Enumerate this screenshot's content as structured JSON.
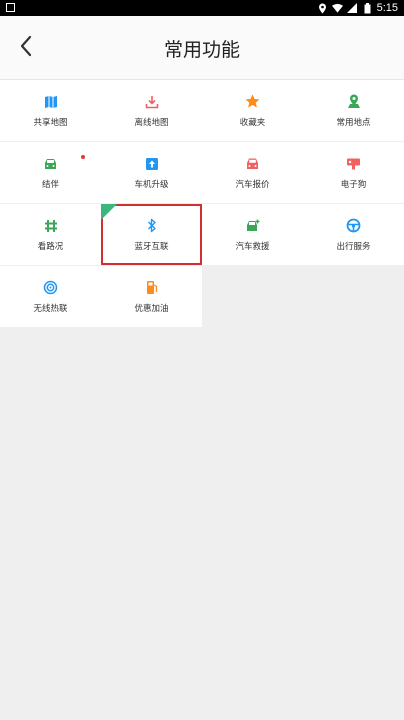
{
  "status_bar": {
    "time": "5:15",
    "icons": [
      "location-icon",
      "wifi-icon",
      "signal-icon",
      "battery-icon"
    ]
  },
  "header": {
    "title": "常用功能",
    "back_icon": "chevron-left-icon"
  },
  "items": [
    {
      "label": "共享地图",
      "icon": "map-icon",
      "color": "#2196f3"
    },
    {
      "label": "离线地图",
      "icon": "download-icon",
      "color": "#f06262"
    },
    {
      "label": "收藏夹",
      "icon": "star-icon",
      "color": "#ff8c1a"
    },
    {
      "label": "常用地点",
      "icon": "location-pin-icon",
      "color": "#3aa757"
    },
    {
      "label": "结伴",
      "icon": "car-group-icon",
      "color": "#3aa757"
    },
    {
      "label": "车机升级",
      "icon": "upgrade-icon",
      "color": "#2196f3"
    },
    {
      "label": "汽车报价",
      "icon": "car-icon",
      "color": "#f06262"
    },
    {
      "label": "电子狗",
      "icon": "camera-icon",
      "color": "#f06262"
    },
    {
      "label": "看路况",
      "icon": "traffic-icon",
      "color": "#3aa757"
    },
    {
      "label": "蓝牙互联",
      "icon": "bluetooth-icon",
      "color": "#2196f3"
    },
    {
      "label": "汽车救援",
      "icon": "car-rescue-icon",
      "color": "#3aa757"
    },
    {
      "label": "出行服务",
      "icon": "steering-wheel-icon",
      "color": "#2196f3"
    },
    {
      "label": "无线热联",
      "icon": "wireless-icon",
      "color": "#2196f3"
    },
    {
      "label": "优惠加油",
      "icon": "fuel-icon",
      "color": "#ff8c1a"
    }
  ],
  "highlight_color": "#d32f2f",
  "badge_color": "#3bb77e",
  "notification_dot_color": "#e53935"
}
